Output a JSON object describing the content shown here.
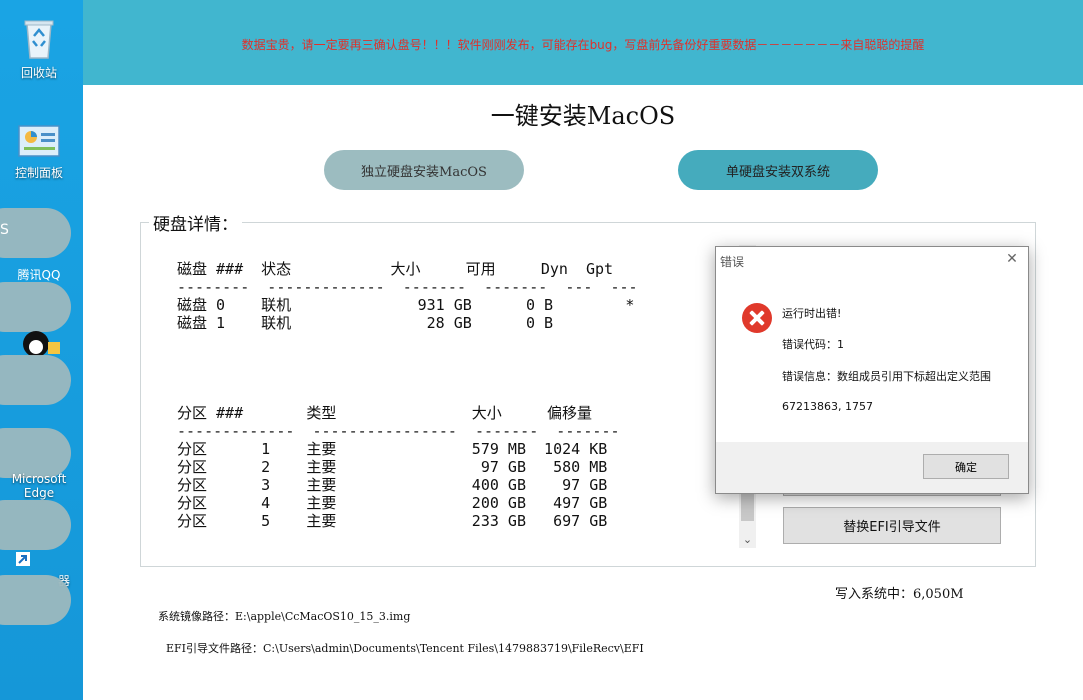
{
  "desktop": {
    "icons": [
      {
        "label": "回收站"
      },
      {
        "label": "控制面板"
      },
      {
        "label": "腾讯QQ"
      },
      {
        "label": "Microsoft Edge"
      },
      {
        "label": "器"
      }
    ],
    "pill_text": "S"
  },
  "app": {
    "warning": "数据宝贵，请一定要再三确认盘号！！！软件刚刚发布，可能存在bug，写盘前先备份好重要数据－－－－－－－来自聪聪的提醒",
    "title": "一键安装MacOS",
    "mode_buttons": {
      "independent": "独立硬盘安装MacOS",
      "dual": "单硬盘安装双系统"
    },
    "disk_legend": "硬盘详情：",
    "disk_text": "磁盘 ###  状态           大小     可用     Dyn  Gpt\n--------  -------------  -------  -------  ---  ---\n磁盘 0    联机              931 GB      0 B        *\n磁盘 1    联机               28 GB      0 B\n\n\n\n\n分区 ###       类型               大小     偏移量\n-------------  ----------------  -------  -------\n分区      1    主要               579 MB  1024 KB\n分区      2    主要                97 GB   580 MB\n分区      3    主要               400 GB    97 GB\n分区      4    主要               200 GB   497 GB\n分区      5    主要               233 GB   697 GB",
    "side_buttons": {
      "replace_efi": "替换EFI引导文件"
    },
    "progress": "写入系统中：6,050M",
    "image_path": "系统镜像路径：E:\\apple\\CcMacOS10_15_3.img",
    "efi_path": "EFI引导文件路径：C:\\Users\\admin\\Documents\\Tencent Files\\1479883719\\FileRecv\\EFI"
  },
  "dialog": {
    "title": "错误",
    "message": "运行时出错!",
    "code_line": "错误代码：1",
    "info_line": "错误信息：数组成员引用下标超出定义范围",
    "numbers_line": "67213863, 1757",
    "ok_label": "确定"
  }
}
